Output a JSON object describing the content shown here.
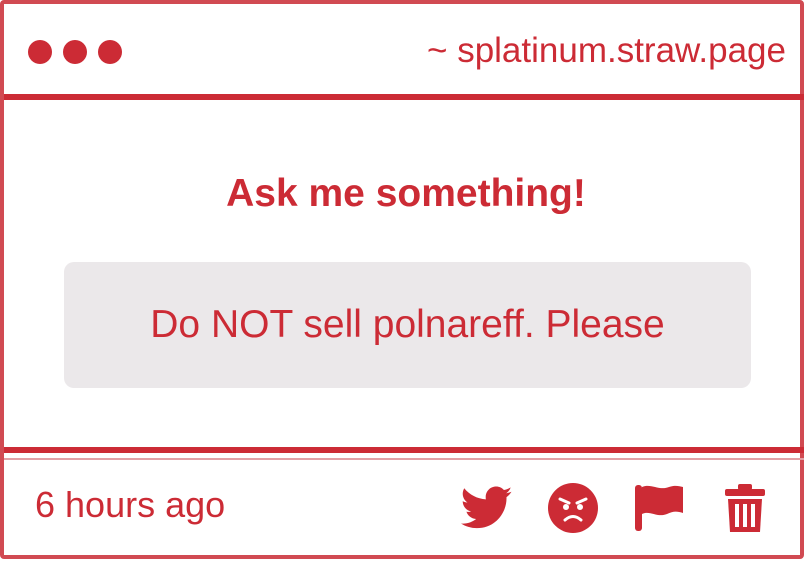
{
  "window": {
    "url": "~ splatinum.straw.page"
  },
  "main": {
    "prompt": "Ask me something!",
    "message": "Do NOT sell polnareff. Please"
  },
  "footer": {
    "timestamp": "6 hours ago",
    "actions": [
      {
        "icon": "twitter-icon"
      },
      {
        "icon": "angry-face-icon"
      },
      {
        "icon": "flag-icon"
      },
      {
        "icon": "trash-icon"
      }
    ]
  },
  "colors": {
    "accent": "#cc2b35",
    "message_background": "#ebe8ea",
    "background": "#ffffff"
  }
}
